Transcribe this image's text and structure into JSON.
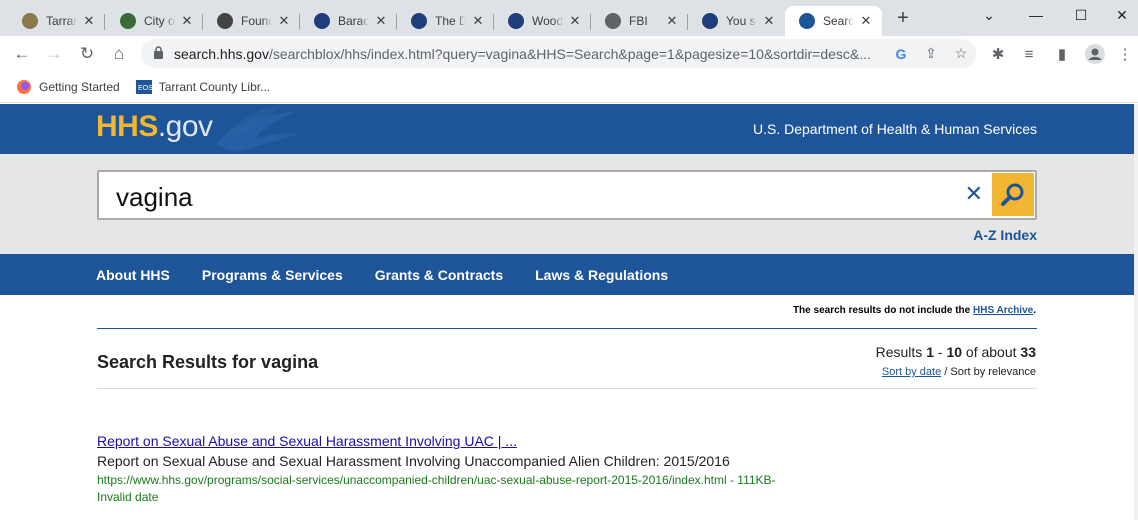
{
  "browser": {
    "tabs": [
      {
        "title": "Tarrant",
        "favicon_color": "#8a7a4a"
      },
      {
        "title": "City of",
        "favicon_color": "#3a6a3a"
      },
      {
        "title": "Found",
        "favicon_color": "#444444"
      },
      {
        "title": "Barack",
        "favicon_color": "#1e3d7a"
      },
      {
        "title": "The D",
        "favicon_color": "#1e3d7a"
      },
      {
        "title": "Wood",
        "favicon_color": "#1e3d7a"
      },
      {
        "title": "FBI",
        "favicon_color": "#5f6368"
      },
      {
        "title": "You se",
        "favicon_color": "#1e3d7a"
      },
      {
        "title": "Search",
        "favicon_color": "#1e5599"
      }
    ],
    "active_tab_index": 8,
    "tab_close_glyph": "✕",
    "new_tab_glyph": "+",
    "url_host": "search.hhs.gov",
    "url_path": "/searchblox/hhs/index.html?query=vagina&HHS=Search&page=1&pagesize=10&sortdir=desc&...",
    "bookmarks": [
      {
        "label": "Getting Started"
      },
      {
        "label": "Tarrant County Libr..."
      }
    ]
  },
  "site": {
    "logo_main": "HHS",
    "logo_suffix": ".gov",
    "department": "U.S. Department of Health & Human Services",
    "search_query": "vagina",
    "az_index": "A-Z Index",
    "nav": [
      "About HHS",
      "Programs & Services",
      "Grants & Contracts",
      "Laws & Regulations"
    ],
    "archive_note_prefix": "The search results do not include the",
    "archive_link": "HHS Archive",
    "archive_note_suffix": ".",
    "results_heading": "Search Results for vagina",
    "count_prefix": "Results",
    "count_from": "1",
    "count_dash": "-",
    "count_to": "10",
    "count_mid": "of about",
    "count_total": "33",
    "sort_by_date": "Sort by date",
    "sort_sep": "/",
    "sort_by_relevance": "Sort by relevance",
    "results": [
      {
        "title": "Report on Sexual Abuse and Sexual Harassment Involving UAC | ...",
        "description": "Report on Sexual Abuse and Sexual Harassment Involving Unaccompanied Alien Children: 2015/2016",
        "url": "https://www.hhs.gov/programs/social-services/unaccompanied-children/uac-sexual-abuse-report-2015-2016/index.html - 111KB- Invalid date"
      }
    ]
  }
}
